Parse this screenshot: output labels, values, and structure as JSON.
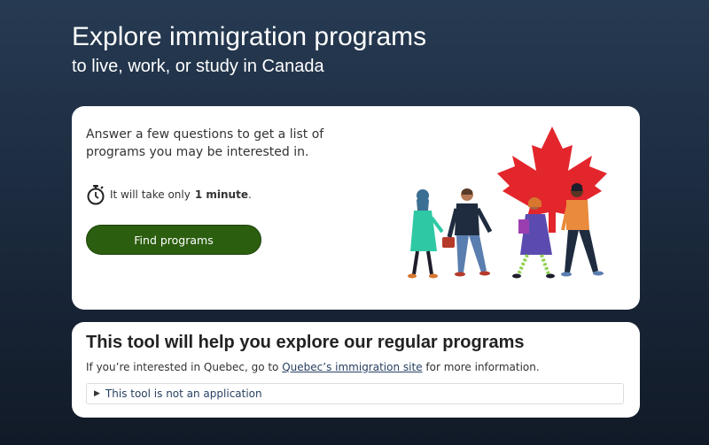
{
  "hero": {
    "title": "Explore immigration programs",
    "subtitle": "to live, work, or study in Canada"
  },
  "intro_card": {
    "text": "Answer a few questions to get a list of programs you may be interested in.",
    "time_prefix": "It will take only",
    "time_bold": "1 minute",
    "time_suffix": ".",
    "button_label": "Find programs",
    "icons": {
      "timer": "stopwatch-icon",
      "illustration": "maple-leaf-people-illustration"
    },
    "colors": {
      "button": "#2b5e0f",
      "leaf": "#e3252c"
    }
  },
  "info_card": {
    "title": "This tool will help you explore our regular programs",
    "quebec_prefix": "If you’re interested in Quebec, go to",
    "quebec_link": "Quebec’s immigration site",
    "quebec_suffix": "for more information.",
    "details_label": "This tool is not an application"
  }
}
